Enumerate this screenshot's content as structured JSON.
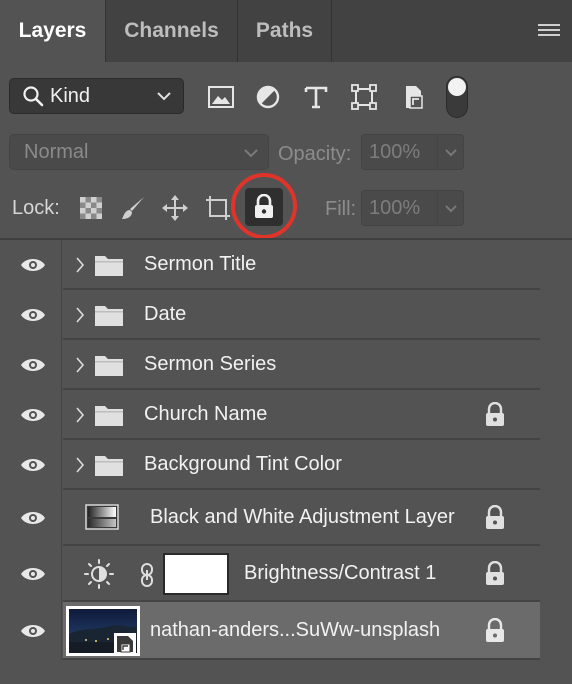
{
  "tabs": [
    {
      "label": "Layers",
      "active": true
    },
    {
      "label": "Channels",
      "active": false
    },
    {
      "label": "Paths",
      "active": false
    }
  ],
  "filter": {
    "kind_label": "Kind",
    "icons": [
      "image-filter-icon",
      "adjustment-filter-icon",
      "type-filter-icon",
      "shape-filter-icon",
      "smart-object-filter-icon",
      "filter-toggle"
    ]
  },
  "blend": {
    "mode": "Normal",
    "opacity_label": "Opacity:",
    "opacity_value": "100%"
  },
  "lock": {
    "label": "Lock:",
    "fill_label": "Fill:",
    "fill_value": "100%",
    "icons": [
      "lock-transparent-pixels-icon",
      "lock-image-pixels-icon",
      "lock-position-icon",
      "lock-artboard-icon",
      "lock-all-icon"
    ]
  },
  "layers": [
    {
      "name": "Sermon Title",
      "type": "group",
      "locked": false,
      "selected": false
    },
    {
      "name": "Date",
      "type": "group",
      "locked": false,
      "selected": false
    },
    {
      "name": "Sermon Series",
      "type": "group",
      "locked": false,
      "selected": false
    },
    {
      "name": "Church Name",
      "type": "group",
      "locked": true,
      "selected": false
    },
    {
      "name": "Background Tint Color",
      "type": "group",
      "locked": false,
      "selected": false
    },
    {
      "name": "Black and White Adjustment Layer",
      "type": "adjustment-bw",
      "locked": true,
      "selected": false
    },
    {
      "name": "Brightness/Contrast 1",
      "type": "adjustment-brightness",
      "locked": true,
      "selected": false
    },
    {
      "name": "nathan-anders...SuWw-unsplash",
      "type": "smart-object",
      "locked": true,
      "selected": true
    }
  ],
  "colors": {
    "panel_bg": "#535353",
    "tab_bg": "#424242",
    "selected_row": "#6b6b6b",
    "highlight_ring": "#e0342b"
  }
}
